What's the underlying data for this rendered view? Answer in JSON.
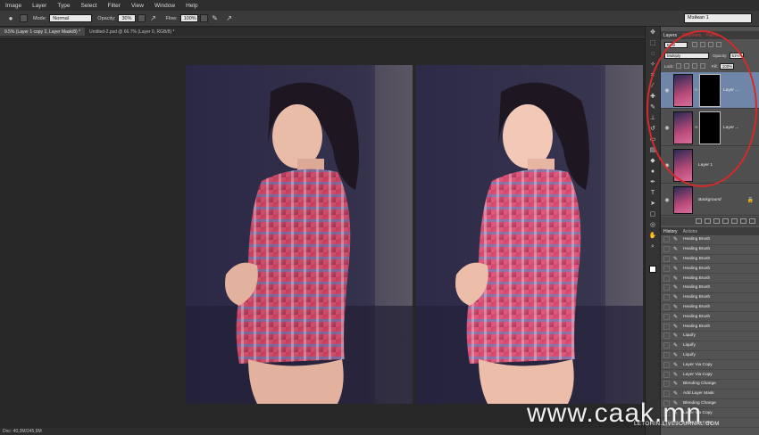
{
  "menu": [
    "Image",
    "Layer",
    "Type",
    "Select",
    "Filter",
    "View",
    "Window",
    "Help"
  ],
  "options": {
    "mode_label": "Mode:",
    "mode_value": "Normal",
    "opacity_label": "Opacity:",
    "opacity_value": "30%",
    "flow_label": "Flow:",
    "flow_value": "100%",
    "workspace": "Мэйкап 1"
  },
  "tabs": [
    {
      "label": "9.5% (Layer 1 copy 2, Layer Mask/8) *",
      "active": true
    },
    {
      "label": "Untitled-2.psd @ 66.7% (Layer 0, RGB/8) *",
      "active": false
    }
  ],
  "status": {
    "doc": "Doc: 40,3M/245,9M"
  },
  "layers_panel": {
    "tabs": [
      "Layers",
      "Channels",
      "Paths"
    ],
    "filter_kind": "Kind",
    "blend_mode": "Multiply",
    "opacity_label": "Opacity:",
    "opacity_value": "51%",
    "lock_label": "Lock:",
    "fill_label": "Fill:",
    "fill_value": "100%",
    "layers": [
      {
        "name": "Layer ...",
        "has_mask": true,
        "selected": true
      },
      {
        "name": "Layer ...",
        "has_mask": true,
        "selected": false
      },
      {
        "name": "Layer 1",
        "has_mask": false,
        "selected": false
      },
      {
        "name": "Background",
        "has_mask": false,
        "selected": false,
        "locked": true
      }
    ]
  },
  "history_panel": {
    "tabs": [
      "History",
      "Actions"
    ],
    "items": [
      "Healing Brush",
      "Healing Brush",
      "Healing Brush",
      "Healing Brush",
      "Healing Brush",
      "Healing Brush",
      "Healing Brush",
      "Healing Brush",
      "Healing Brush",
      "Healing Brush",
      "Liquify",
      "Liquify",
      "Liquify",
      "Layer Via Copy",
      "Layer Via Copy",
      "Blending Change",
      "Add Layer Mask",
      "Blending Change",
      "Layer Via Copy",
      "Layer Via Copy"
    ]
  },
  "watermark": {
    "main": "www.caak.mn",
    "sub": "LETOHIN.LIVEJOURNAL.COM"
  },
  "colors": {
    "annotation": "#d42a2a",
    "selected_layer": "#6f86a8"
  }
}
